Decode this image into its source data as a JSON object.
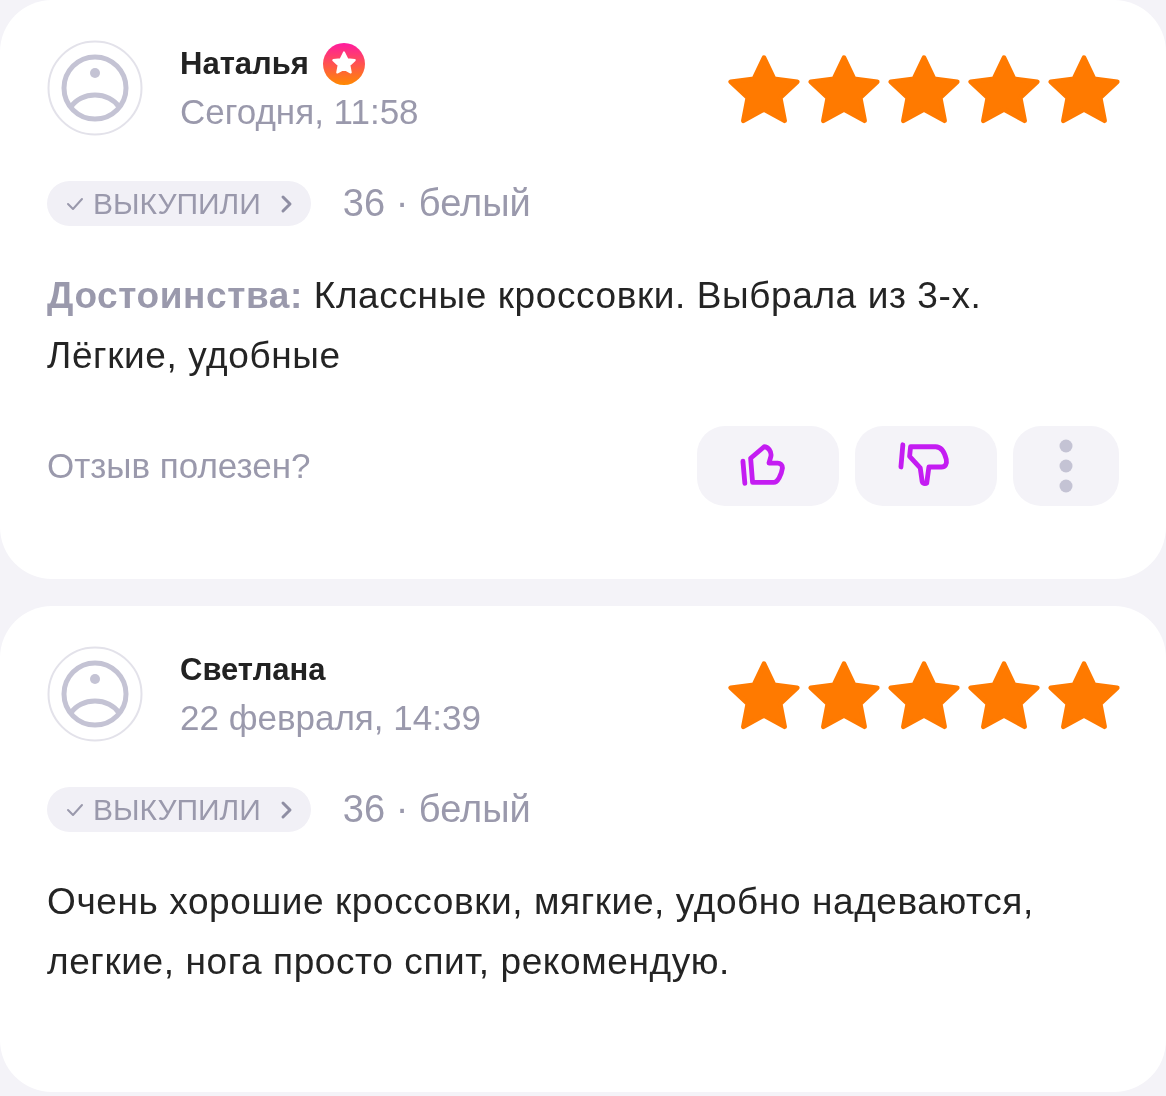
{
  "reviews": [
    {
      "name": "Наталья",
      "badge": true,
      "date": "Сегодня, 11:58",
      "stars": 5,
      "chip": "ВЫКУПИЛИ",
      "variant": "36 · белый",
      "label": "Достоинства:",
      "text": "Классные кроссовки. Выбрала из 3-х. Лёгкие, удобные",
      "helpful": "Отзыв полезен?"
    },
    {
      "name": "Светлана",
      "badge": false,
      "date": "22 февраля, 14:39",
      "stars": 5,
      "chip": "ВЫКУПИЛИ",
      "variant": "36 · белый",
      "text": "Очень хорошие кроссовки, мягкие, удобно надеваются, легкие, нога просто спит, рекомендую."
    }
  ]
}
